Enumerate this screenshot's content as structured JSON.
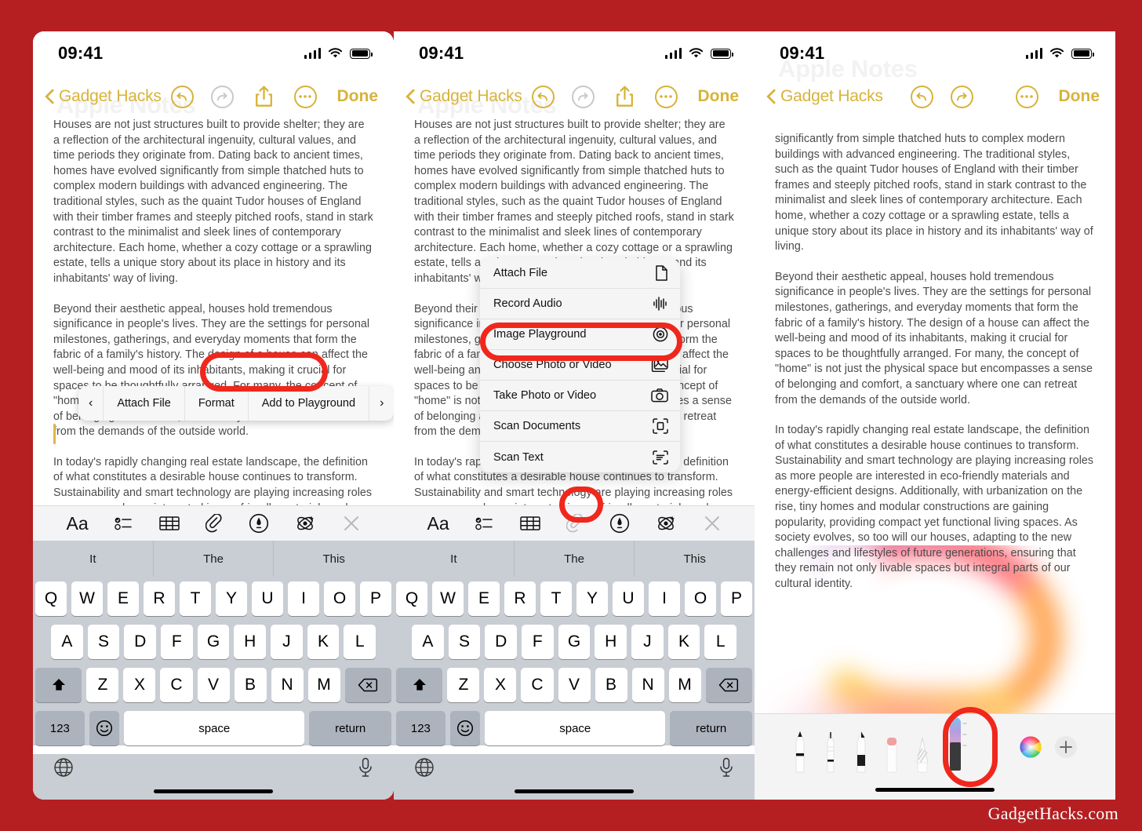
{
  "brand": {
    "label": "GadgetHacks.com"
  },
  "colors": {
    "background_red": "#b51f22",
    "highlight_red": "#f0271c",
    "accent_gold": "#d8b33a",
    "text_gray": "#4b4b4b"
  },
  "statusbar": {
    "time": "09:41",
    "signal_icon": "cellular-bars-icon",
    "wifi_icon": "wifi-icon",
    "battery_icon": "battery-full-icon"
  },
  "navbar": {
    "back_label": "Gadget Hacks",
    "back_icon": "chevron-left-icon",
    "undo_icon": "undo-icon",
    "redo_icon": "redo-icon",
    "share_icon": "share-icon",
    "more_icon": "ellipsis-icon",
    "done_label": "Done"
  },
  "note": {
    "watermark_title": "Apple Notes",
    "paragraphs": [
      "Houses are not just structures built to provide shelter; they are a reflection of the architectural ingenuity, cultural values, and time periods they originate from. Dating back to ancient times, homes have evolved significantly from simple thatched huts to complex modern buildings with advanced engineering. The traditional styles, such as the quaint Tudor houses of England with their timber frames and steeply pitched roofs, stand in stark contrast to the minimalist and sleek lines of contemporary architecture. Each home, whether a cozy cottage or a sprawling estate, tells a unique story about its place in history and its inhabitants' way of living.",
      "Beyond their aesthetic appeal, houses hold tremendous significance in people's lives. They are the settings for personal milestones, gatherings, and everyday moments that form the fabric of a family's history. The design of a house can affect the well-being and mood of its inhabitants, making it crucial for spaces to be thoughtfully arranged. For many, the concept of \"home\" is not just the physical space but encompasses a sense of belonging and comfort, a sanctuary where one can retreat from the demands of the outside world.",
      "In today's rapidly changing real estate landscape, the definition of what constitutes a desirable house continues to transform. Sustainability and smart technology are playing increasing roles as more people are interested in eco-friendly materials and energy-efficient designs. Additionally, with urbanization on the rise, tiny homes and modular constructions are gaining popularity, providing compact yet functional living spaces. As society evolves, so too will our houses, adapting to the new challenges and lifestyles of future generations, ensuring that they remain not only livable spaces but integral parts of our cultural identity."
    ],
    "scrolled_partial_top": "significantly from simple thatched huts to complex modern buildings with advanced engineering. The traditional styles, such as the quaint Tudor houses of England with their timber frames and steeply pitched roofs, stand in stark contrast to the minimalist and sleek lines of contemporary architecture. Each home, whether a cozy cottage or a sprawling estate, tells a unique story about its place in history and its inhabitants' way of living."
  },
  "edit_menu": {
    "prev_icon": "chevron-left-icon",
    "next_icon": "chevron-right-icon",
    "items": [
      {
        "label": "Attach File",
        "highlighted": false
      },
      {
        "label": "Format",
        "highlighted": false
      },
      {
        "label": "Add to Playground",
        "highlighted": true
      }
    ]
  },
  "attach_menu": {
    "items": [
      {
        "label": "Attach File",
        "icon": "document-icon",
        "highlighted": false
      },
      {
        "label": "Record Audio",
        "icon": "waveform-icon",
        "highlighted": false
      },
      {
        "label": "Image Playground",
        "icon": "image-playground-icon",
        "highlighted": true
      },
      {
        "label": "Choose Photo or Video",
        "icon": "photo-library-icon",
        "highlighted": false
      },
      {
        "label": "Take Photo or Video",
        "icon": "camera-icon",
        "highlighted": false
      },
      {
        "label": "Scan Documents",
        "icon": "scan-document-icon",
        "highlighted": false
      },
      {
        "label": "Scan Text",
        "icon": "scan-text-icon",
        "highlighted": false
      }
    ]
  },
  "keyboard_toolbar": {
    "items": [
      {
        "name": "format-aa-button",
        "label": "Aa",
        "icon": "format-text-icon"
      },
      {
        "name": "checklist-button",
        "label": "",
        "icon": "checklist-icon"
      },
      {
        "name": "table-button",
        "label": "",
        "icon": "table-icon"
      },
      {
        "name": "attach-button",
        "label": "",
        "icon": "paperclip-icon"
      },
      {
        "name": "markup-button",
        "label": "",
        "icon": "markup-pen-icon"
      },
      {
        "name": "apple-intelligence-button",
        "label": "",
        "icon": "apple-intelligence-icon"
      },
      {
        "name": "close-keyboard-button",
        "label": "",
        "icon": "close-icon"
      }
    ]
  },
  "predictive": {
    "suggestions": [
      "It",
      "The",
      "This"
    ]
  },
  "keyboard": {
    "row1": [
      "Q",
      "W",
      "E",
      "R",
      "T",
      "Y",
      "U",
      "I",
      "O",
      "P"
    ],
    "row2": [
      "A",
      "S",
      "D",
      "F",
      "G",
      "H",
      "J",
      "K",
      "L"
    ],
    "row3": [
      "Z",
      "X",
      "C",
      "V",
      "B",
      "N",
      "M"
    ],
    "shift_icon": "shift-up-icon",
    "backspace_icon": "backspace-icon",
    "numbers_label": "123",
    "emoji_icon": "emoji-smiley-icon",
    "space_label": "space",
    "return_label": "return",
    "globe_icon": "globe-icon",
    "dictation_icon": "microphone-icon"
  },
  "markup_toolbar": {
    "tools": [
      {
        "name": "pen-tool",
        "icon": "pen-icon",
        "selected": false
      },
      {
        "name": "pencil-tool",
        "icon": "pencil-icon",
        "selected": false
      },
      {
        "name": "marker-tool",
        "icon": "marker-icon",
        "selected": false
      },
      {
        "name": "eraser-tool",
        "icon": "eraser-icon",
        "selected": false
      },
      {
        "name": "lasso-tool",
        "icon": "lasso-icon",
        "selected": false
      },
      {
        "name": "image-wand-tool",
        "icon": "image-wand-icon",
        "selected": true
      }
    ],
    "color_picker_icon": "color-wheel-icon",
    "add_icon": "plus-icon"
  },
  "annotations": [
    {
      "target": "Add to Playground",
      "panel": 1
    },
    {
      "target": "Image Playground",
      "panel": 2
    },
    {
      "target": "paperclip-icon",
      "panel": 2
    },
    {
      "target": "image-wand-tool",
      "panel": 3
    }
  ]
}
